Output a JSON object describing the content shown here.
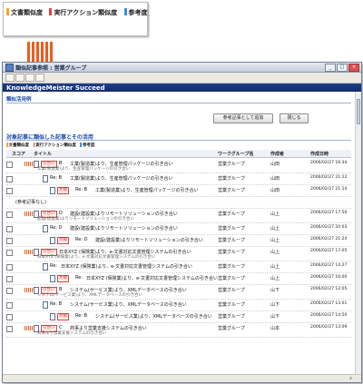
{
  "legend": {
    "items": [
      {
        "label": "文書類似度",
        "color": "#f5a623"
      },
      {
        "label": "実行アクション類似度",
        "color": "#e8423a"
      },
      {
        "label": "参考度",
        "color": "#3a8ee8"
      }
    ],
    "bar_color": "#ef5b1a"
  },
  "window": {
    "title": "類似記事参照 : 営業グループ",
    "brand": "KnowledgeMeister Succeed",
    "buttons": {
      "minimize": "_",
      "maximize": "□",
      "close": "×"
    }
  },
  "content": {
    "breadcrumb": "類似活用例",
    "add_reference_button": "参考記事として追加",
    "close_button": "閉じる",
    "section_title": "対象記事に類似した記事とその活用",
    "mini_legend": [
      "文書類似度",
      "実行アクション類似度",
      "参考度"
    ],
    "table": {
      "headers": {
        "score": "スコア",
        "title": "タイトル",
        "workgroup": "ワークグループ名",
        "author": "作成者",
        "created": "作成日時"
      },
      "rows": [
        {
          "type": "main",
          "tag": "引合い",
          "marker": "B",
          "title": "工業(製造業)より、生産管理パッケージの引き合い",
          "summary": "工業(製造業)より、生産管理パッケージの引き合い",
          "group": "営業グループ",
          "author": "山田",
          "date": "2006/02/27 16:34"
        },
        {
          "type": "sub",
          "tag": "",
          "marker": "Re: B",
          "title": "工業(製造業)より、生産管理パッケージの引き合い",
          "summary": "",
          "group": "営業グループ",
          "author": "山田",
          "date": "2006/02/27 21:12"
        },
        {
          "type": "sub2",
          "tag": "見積",
          "marker": "Re: B",
          "title": "工業(製造業)より、生産管理パッケージの引き合い",
          "summary": "",
          "group": "営業グループ",
          "author": "山田",
          "date": "2006/02/27 21:14"
        },
        {
          "type": "note",
          "tag": "",
          "marker": "",
          "title": "(参考記事なし)",
          "summary": "",
          "group": "",
          "author": "",
          "date": ""
        },
        {
          "type": "main",
          "tag": "引合い",
          "marker": "D",
          "title": "建設(建設業)よりリモートソリューションの引き合い",
          "summary": "建設(建設業)よりリモートソリューションの引き合い",
          "group": "営業グループ",
          "author": "山上",
          "date": "2006/02/27 17:50"
        },
        {
          "type": "sub",
          "tag": "",
          "marker": "Re: D",
          "title": "建設(建設業)よりリモートソリューションの引き合い",
          "summary": "",
          "group": "営業グループ",
          "author": "山上",
          "date": "2006/02/27 20:03"
        },
        {
          "type": "sub2",
          "tag": "見積",
          "marker": "Re: D",
          "title": "建設(建設業)よりリモートソリューションの引き合い",
          "summary": "",
          "group": "営業グループ",
          "author": "山上",
          "date": "2006/02/27 21:24"
        },
        {
          "type": "main",
          "tag": "引合い",
          "marker": "日本XYZ",
          "title": "(保険業)より、e-文書対応文書管理システムの引き合い",
          "summary": "日本XYZ (保険業)より、e-文書対応文書管理システムの引き合い",
          "group": "営業グループ",
          "author": "山上",
          "date": "2006/02/27 17:05"
        },
        {
          "type": "sub",
          "tag": "",
          "marker": "Re:",
          "title": "日本XYZ (保険業)より、e-文書対応文書管理システムの引き合い",
          "summary": "",
          "group": "営業グループ",
          "author": "山上",
          "date": "2006/02/27 14:27"
        },
        {
          "type": "sub2",
          "tag": "見積",
          "marker": "Re:",
          "title": "日本XYZ (保険業)より、e-文書対応文書管理システムの引き合い",
          "summary": "",
          "group": "営業グループ",
          "author": "山上",
          "date": "2006/02/27 16:00"
        },
        {
          "type": "main",
          "tag": "引合い",
          "marker": "B",
          "title": "システム(サービス業)より、XMLデータベースの引き合い",
          "summary": "システム(サービス業)より、XMLデータベースの引き合い",
          "group": "営業グループ",
          "author": "山下",
          "date": "2006/02/27 12:05"
        },
        {
          "type": "sub",
          "tag": "",
          "marker": "Re: B",
          "title": "システム(サービス業)より、XMLデータベースの引き合い",
          "summary": "",
          "group": "営業グループ",
          "author": "山下",
          "date": "2006/02/27 13:01"
        },
        {
          "type": "sub2",
          "tag": "見積",
          "marker": "Re: B",
          "title": "システム(サービス業)より、XMLデータベースの引き合い",
          "summary": "",
          "group": "営業グループ",
          "author": "山下",
          "date": "2006/02/27 14:50"
        },
        {
          "type": "main",
          "tag": "引合い",
          "marker": "C",
          "title": "商事より営業支援システムの引き合い",
          "summary": "商事より営業支援システムの引き合い",
          "group": "営業グループ",
          "author": "山本",
          "date": "2006/02/27 13:09"
        }
      ]
    }
  }
}
